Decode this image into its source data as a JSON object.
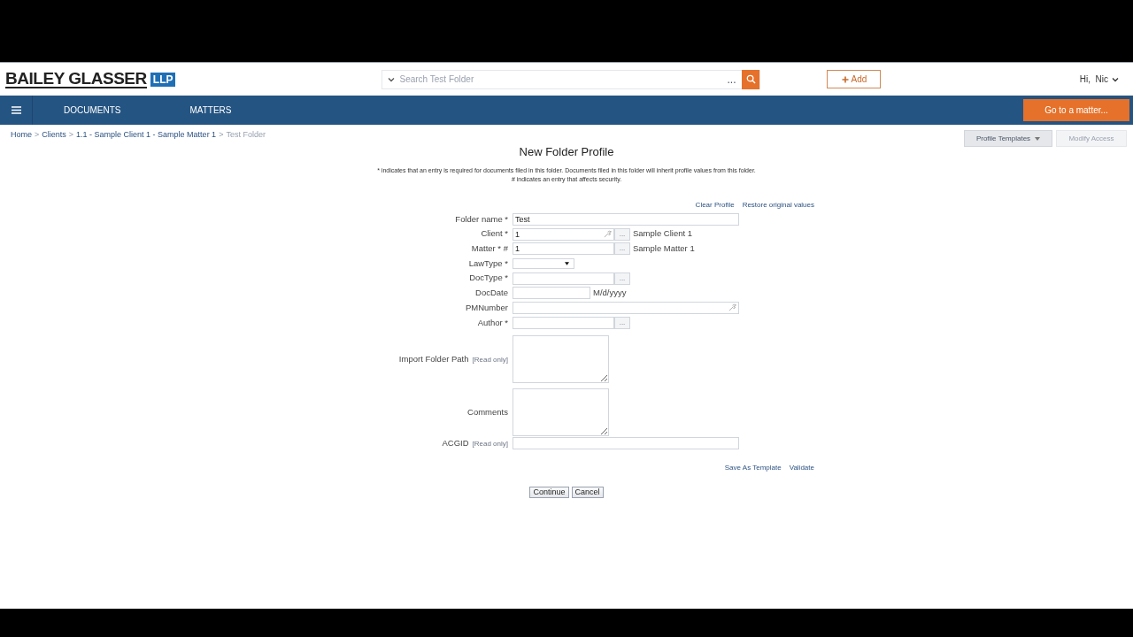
{
  "header": {
    "logo": {
      "name": "BAILEY GLASSER",
      "suffix": "LLP"
    },
    "search": {
      "placeholder": "Search Test Folder",
      "more": "..."
    },
    "add_button": "Add",
    "user": "Hi,  Nic"
  },
  "nav": {
    "items": [
      {
        "label": "DOCUMENTS"
      },
      {
        "label": "MATTERS"
      }
    ],
    "go_button": "Go to a matter..."
  },
  "breadcrumb": [
    {
      "kind": "link",
      "text": "Home"
    },
    {
      "kind": "separator",
      "text": ">"
    },
    {
      "kind": "link",
      "text": "Clients"
    },
    {
      "kind": "separator",
      "text": ">"
    },
    {
      "kind": "link",
      "text": "1.1 - Sample Client 1 - Sample Matter 1"
    },
    {
      "kind": "separator",
      "text": ">"
    },
    {
      "kind": "current",
      "text": "Test Folder"
    }
  ],
  "toolbar": [
    {
      "label": "Profile Templates",
      "disabled": false,
      "dropdown": true
    },
    {
      "label": "Modify Access",
      "disabled": true,
      "dropdown": false
    }
  ],
  "form": {
    "title": "New Folder Profile",
    "notes": [
      "* indicates that an entry is required for documents filed in this folder. Documents filed in this folder will inherit profile values from this folder.",
      "# indicates an entry that affects security."
    ],
    "top_links": [
      "Clear Profile",
      "Restore original values"
    ],
    "fields": [
      {
        "kind": "text",
        "label": "Folder name *",
        "value": "Test",
        "wrench": false
      },
      {
        "kind": "lookup",
        "label": "Client *",
        "value": "1",
        "wrench": true,
        "browse": "...",
        "after": "Sample Client 1"
      },
      {
        "kind": "lookup",
        "label": "Matter * #",
        "value": "1",
        "wrench": false,
        "browse": "...",
        "after": "Sample Matter 1"
      },
      {
        "kind": "select",
        "label": "LawType *"
      },
      {
        "kind": "lookup",
        "label": "DocType *",
        "wrench": false,
        "browse": "..."
      },
      {
        "kind": "date",
        "label": "DocDate",
        "after": "M/d/yyyy"
      },
      {
        "kind": "text",
        "label": "PMNumber",
        "wrench": true
      },
      {
        "kind": "lookup",
        "label": "Author *",
        "wrench": false,
        "browse": "..."
      },
      {
        "kind": "textarea",
        "label": "Import Folder Path",
        "tag": "[Read only]"
      },
      {
        "kind": "textarea",
        "label": "Comments"
      },
      {
        "kind": "text",
        "label": "ACGID",
        "tag": "[Read only]",
        "wrench": false
      }
    ],
    "bottom_links": [
      "Save As Template",
      "Validate"
    ],
    "buttons": [
      "Continue",
      "Cancel"
    ]
  }
}
